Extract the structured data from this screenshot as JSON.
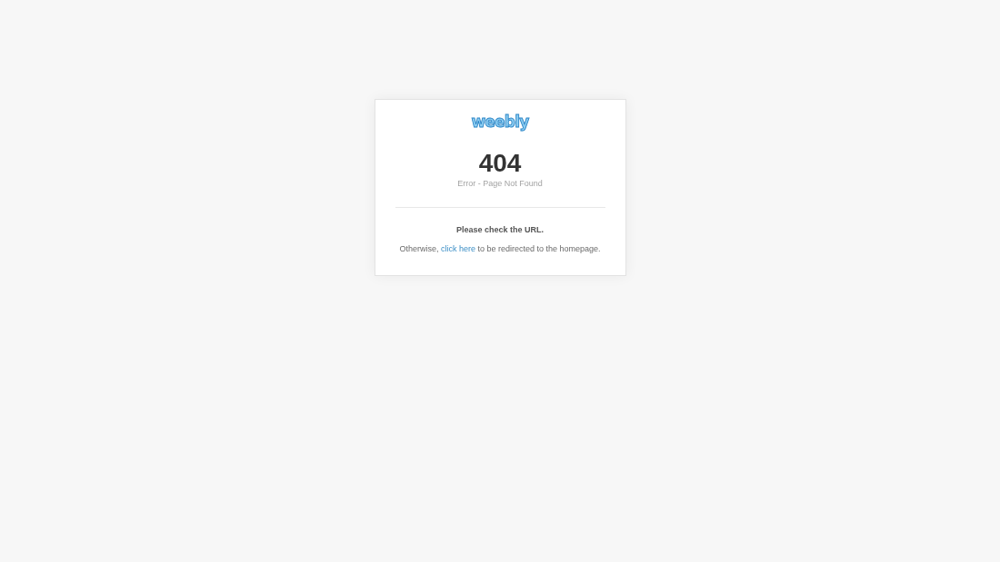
{
  "card": {
    "logo": "weebly",
    "error_code": "404",
    "error_message": "Error - Page Not Found",
    "instruction": "Please check the URL.",
    "redirect_note": {
      "before": "Otherwise,",
      "link": "click here",
      "after": "to be redirected to the homepage."
    }
  }
}
